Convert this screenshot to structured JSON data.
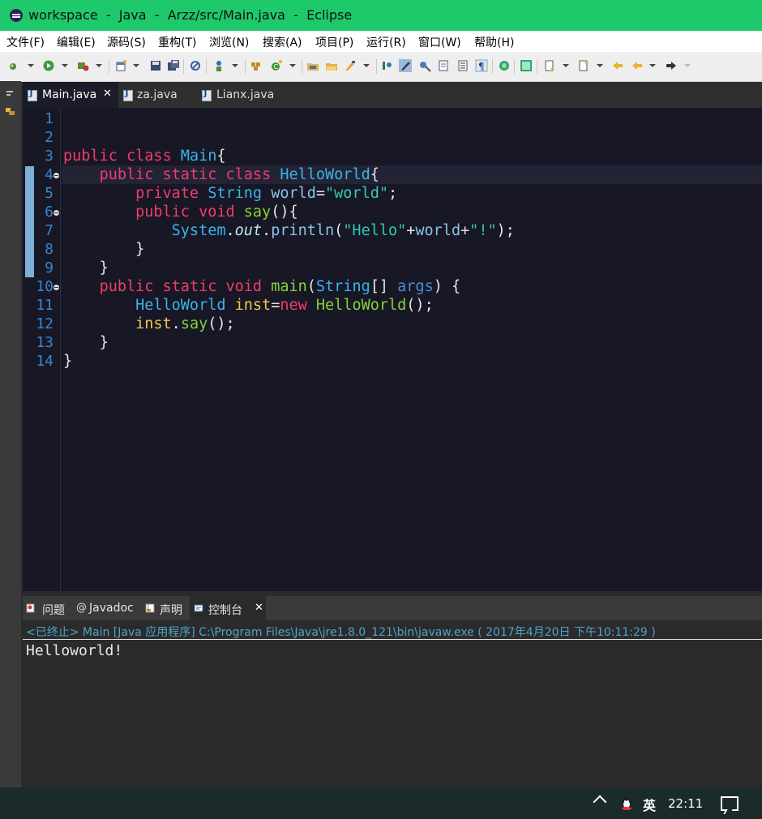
{
  "window": {
    "title": "workspace  -  Java  -  Arzz/src/Main.java  -  Eclipse"
  },
  "menu": [
    "文件(F)",
    "编辑(E)",
    "源码(S)",
    "重构(T)",
    "浏览(N)",
    "搜索(A)",
    "项目(P)",
    "运行(R)",
    "窗口(W)",
    "帮助(H)"
  ],
  "editor_tabs": [
    {
      "label": "Main.java",
      "close": "✕"
    },
    {
      "label": "za.java"
    },
    {
      "label": "Lianx.java"
    }
  ],
  "line_numbers": [
    "1",
    "2",
    "3",
    "4",
    "5",
    "6",
    "7",
    "8",
    "9",
    "10",
    "11",
    "12",
    "13",
    "14"
  ],
  "code": {
    "l3": {
      "kw1": "public",
      "kw2": "class",
      "name": "Main",
      "brace": "{"
    },
    "l4": {
      "kw1": "public",
      "kw2": "static",
      "kw3": "class",
      "name": "HelloWorld",
      "brace": "{"
    },
    "l5": {
      "kw1": "private",
      "type": "String",
      "field": "world",
      "eq": "=",
      "str": "\"world\"",
      "semi": ";"
    },
    "l6": {
      "kw1": "public",
      "kw2": "void",
      "method": "say",
      "rest": "(){"
    },
    "l7": {
      "cls": "System",
      "dot1": ".",
      "out": "out",
      "dot2": ".",
      "method": "println",
      "p1": "(",
      "s1": "\"Hello\"",
      "plus1": "+",
      "field": "world",
      "plus2": "+",
      "s2": "\"!\"",
      "end": ");"
    },
    "l8": {
      "text": "}"
    },
    "l9": {
      "text": "}"
    },
    "l10": {
      "kw1": "public",
      "kw2": "static",
      "kw3": "void",
      "method": "main",
      "p1": "(",
      "type": "String",
      "arr": "[] ",
      "param": "args",
      "end": ") {"
    },
    "l11": {
      "type": "HelloWorld",
      "var": "inst",
      "eq": "=",
      "kw": "new",
      "ctor": "HelloWorld",
      "end": "();"
    },
    "l12": {
      "var": "inst",
      "dot": ".",
      "method": "say",
      "end": "();"
    },
    "l13": {
      "text": "}"
    },
    "l14": {
      "text": "}"
    }
  },
  "bottom_tabs": [
    "问题",
    "Javadoc",
    "声明",
    "控制台"
  ],
  "bottom_close": "✕",
  "console": {
    "status": "<已终止> Main [Java 应用程序] C:\\Program Files\\Java\\jre1.8.0_121\\bin\\javaw.exe ( 2017年4月20日 下午10:11:29 )",
    "output": "Helloworld!"
  },
  "taskbar": {
    "ime": "英",
    "clock": "22:11"
  }
}
